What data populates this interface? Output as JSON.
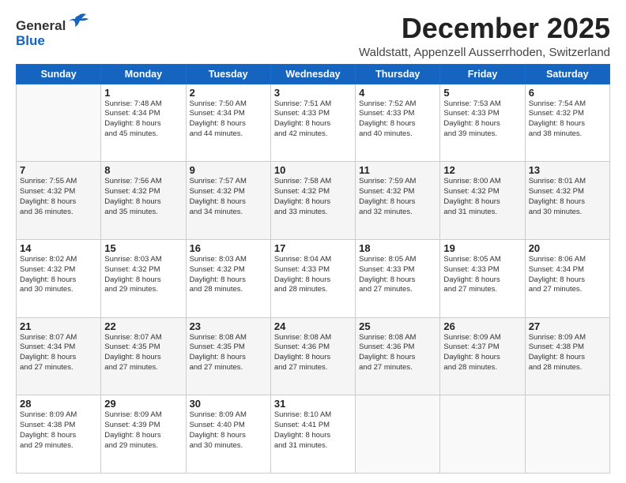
{
  "header": {
    "logo_line1": "General",
    "logo_line2": "Blue",
    "month": "December 2025",
    "location": "Waldstatt, Appenzell Ausserrhoden, Switzerland"
  },
  "weekdays": [
    "Sunday",
    "Monday",
    "Tuesday",
    "Wednesday",
    "Thursday",
    "Friday",
    "Saturday"
  ],
  "weeks": [
    [
      {
        "day": "",
        "info": ""
      },
      {
        "day": "1",
        "info": "Sunrise: 7:48 AM\nSunset: 4:34 PM\nDaylight: 8 hours\nand 45 minutes."
      },
      {
        "day": "2",
        "info": "Sunrise: 7:50 AM\nSunset: 4:34 PM\nDaylight: 8 hours\nand 44 minutes."
      },
      {
        "day": "3",
        "info": "Sunrise: 7:51 AM\nSunset: 4:33 PM\nDaylight: 8 hours\nand 42 minutes."
      },
      {
        "day": "4",
        "info": "Sunrise: 7:52 AM\nSunset: 4:33 PM\nDaylight: 8 hours\nand 40 minutes."
      },
      {
        "day": "5",
        "info": "Sunrise: 7:53 AM\nSunset: 4:33 PM\nDaylight: 8 hours\nand 39 minutes."
      },
      {
        "day": "6",
        "info": "Sunrise: 7:54 AM\nSunset: 4:32 PM\nDaylight: 8 hours\nand 38 minutes."
      }
    ],
    [
      {
        "day": "7",
        "info": "Sunrise: 7:55 AM\nSunset: 4:32 PM\nDaylight: 8 hours\nand 36 minutes."
      },
      {
        "day": "8",
        "info": "Sunrise: 7:56 AM\nSunset: 4:32 PM\nDaylight: 8 hours\nand 35 minutes."
      },
      {
        "day": "9",
        "info": "Sunrise: 7:57 AM\nSunset: 4:32 PM\nDaylight: 8 hours\nand 34 minutes."
      },
      {
        "day": "10",
        "info": "Sunrise: 7:58 AM\nSunset: 4:32 PM\nDaylight: 8 hours\nand 33 minutes."
      },
      {
        "day": "11",
        "info": "Sunrise: 7:59 AM\nSunset: 4:32 PM\nDaylight: 8 hours\nand 32 minutes."
      },
      {
        "day": "12",
        "info": "Sunrise: 8:00 AM\nSunset: 4:32 PM\nDaylight: 8 hours\nand 31 minutes."
      },
      {
        "day": "13",
        "info": "Sunrise: 8:01 AM\nSunset: 4:32 PM\nDaylight: 8 hours\nand 30 minutes."
      }
    ],
    [
      {
        "day": "14",
        "info": "Sunrise: 8:02 AM\nSunset: 4:32 PM\nDaylight: 8 hours\nand 30 minutes."
      },
      {
        "day": "15",
        "info": "Sunrise: 8:03 AM\nSunset: 4:32 PM\nDaylight: 8 hours\nand 29 minutes."
      },
      {
        "day": "16",
        "info": "Sunrise: 8:03 AM\nSunset: 4:32 PM\nDaylight: 8 hours\nand 28 minutes."
      },
      {
        "day": "17",
        "info": "Sunrise: 8:04 AM\nSunset: 4:33 PM\nDaylight: 8 hours\nand 28 minutes."
      },
      {
        "day": "18",
        "info": "Sunrise: 8:05 AM\nSunset: 4:33 PM\nDaylight: 8 hours\nand 27 minutes."
      },
      {
        "day": "19",
        "info": "Sunrise: 8:05 AM\nSunset: 4:33 PM\nDaylight: 8 hours\nand 27 minutes."
      },
      {
        "day": "20",
        "info": "Sunrise: 8:06 AM\nSunset: 4:34 PM\nDaylight: 8 hours\nand 27 minutes."
      }
    ],
    [
      {
        "day": "21",
        "info": "Sunrise: 8:07 AM\nSunset: 4:34 PM\nDaylight: 8 hours\nand 27 minutes."
      },
      {
        "day": "22",
        "info": "Sunrise: 8:07 AM\nSunset: 4:35 PM\nDaylight: 8 hours\nand 27 minutes."
      },
      {
        "day": "23",
        "info": "Sunrise: 8:08 AM\nSunset: 4:35 PM\nDaylight: 8 hours\nand 27 minutes."
      },
      {
        "day": "24",
        "info": "Sunrise: 8:08 AM\nSunset: 4:36 PM\nDaylight: 8 hours\nand 27 minutes."
      },
      {
        "day": "25",
        "info": "Sunrise: 8:08 AM\nSunset: 4:36 PM\nDaylight: 8 hours\nand 27 minutes."
      },
      {
        "day": "26",
        "info": "Sunrise: 8:09 AM\nSunset: 4:37 PM\nDaylight: 8 hours\nand 28 minutes."
      },
      {
        "day": "27",
        "info": "Sunrise: 8:09 AM\nSunset: 4:38 PM\nDaylight: 8 hours\nand 28 minutes."
      }
    ],
    [
      {
        "day": "28",
        "info": "Sunrise: 8:09 AM\nSunset: 4:38 PM\nDaylight: 8 hours\nand 29 minutes."
      },
      {
        "day": "29",
        "info": "Sunrise: 8:09 AM\nSunset: 4:39 PM\nDaylight: 8 hours\nand 29 minutes."
      },
      {
        "day": "30",
        "info": "Sunrise: 8:09 AM\nSunset: 4:40 PM\nDaylight: 8 hours\nand 30 minutes."
      },
      {
        "day": "31",
        "info": "Sunrise: 8:10 AM\nSunset: 4:41 PM\nDaylight: 8 hours\nand 31 minutes."
      },
      {
        "day": "",
        "info": ""
      },
      {
        "day": "",
        "info": ""
      },
      {
        "day": "",
        "info": ""
      }
    ]
  ]
}
